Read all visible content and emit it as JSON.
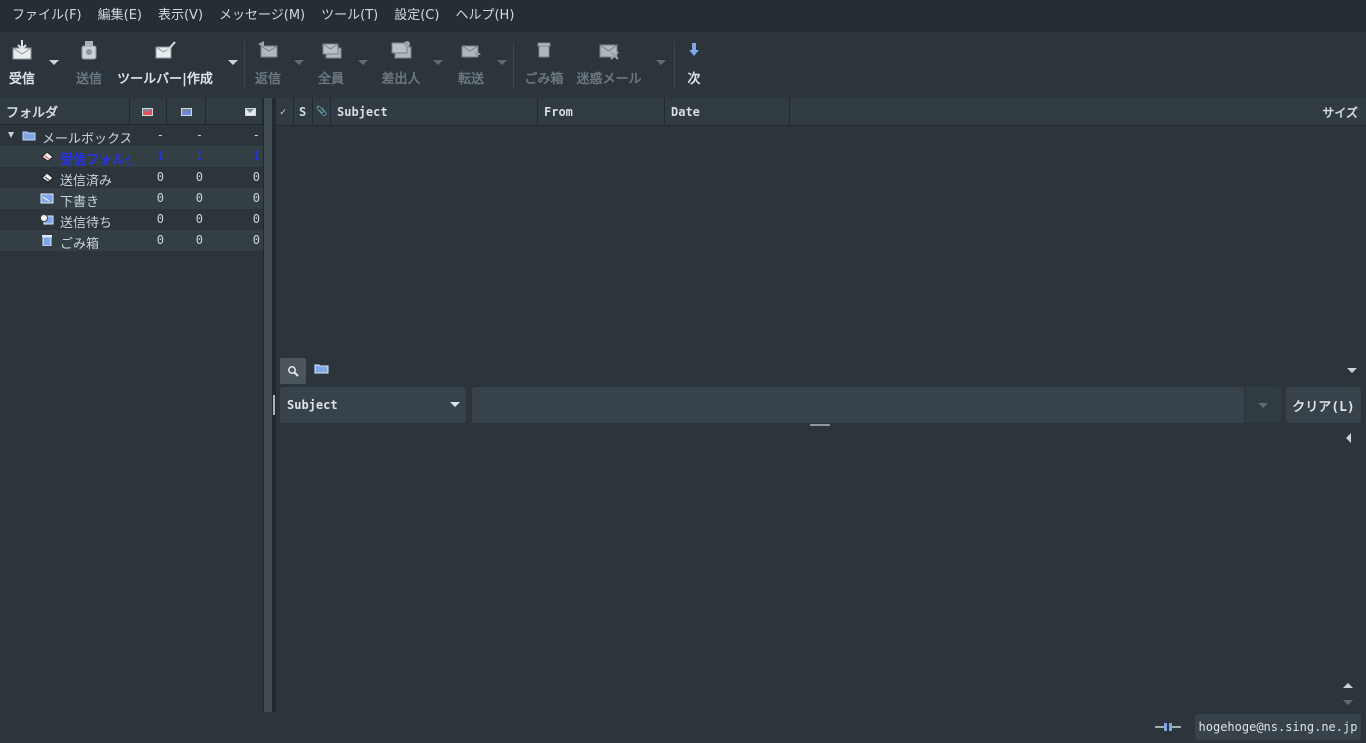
{
  "menu": [
    {
      "label": "ファイル(F)"
    },
    {
      "label": "編集(E)"
    },
    {
      "label": "表示(V)"
    },
    {
      "label": "メッセージ(M)"
    },
    {
      "label": "ツール(T)"
    },
    {
      "label": "設定(C)"
    },
    {
      "label": "ヘルプ(H)"
    }
  ],
  "toolbar": {
    "receive": "受信",
    "send": "送信",
    "compose": "ツールバー|作成",
    "reply": "返信",
    "reply_all": "全員",
    "reply_sender": "差出人",
    "forward": "転送",
    "trash": "ごみ箱",
    "junk": "迷惑メール",
    "next": "次"
  },
  "folder_pane": {
    "header": "フォルダ",
    "icons": [
      "new-mail-icon",
      "unread-mail-icon",
      "total-mail-icon"
    ],
    "folders": [
      {
        "name": "メールボックス",
        "new": "-",
        "unread": "-",
        "total": "-",
        "icon": "mailbox-icon"
      },
      {
        "name": "受信フォルダ",
        "new": "1",
        "unread": "1",
        "total": "1",
        "icon": "inbox-icon",
        "color": "#2233ee"
      },
      {
        "name": "送信済み",
        "new": "0",
        "unread": "0",
        "total": "0",
        "icon": "sent-icon"
      },
      {
        "name": "下書き",
        "new": "0",
        "unread": "0",
        "total": "0",
        "icon": "draft-icon"
      },
      {
        "name": "送信待ち",
        "new": "0",
        "unread": "0",
        "total": "0",
        "icon": "queue-icon"
      },
      {
        "name": "ごみ箱",
        "new": "0",
        "unread": "0",
        "total": "0",
        "icon": "trash-icon"
      }
    ]
  },
  "message_list": {
    "columns": {
      "mark": "✓",
      "status": "S",
      "attach": "📎",
      "subject": "Subject",
      "from": "From",
      "date": "Date",
      "size": "サイズ"
    }
  },
  "quick_search": {
    "field": "Subject",
    "value": "",
    "clear": "クリア(L)"
  },
  "status": {
    "account": "hogehoge@ns.sing.ne.jp"
  }
}
